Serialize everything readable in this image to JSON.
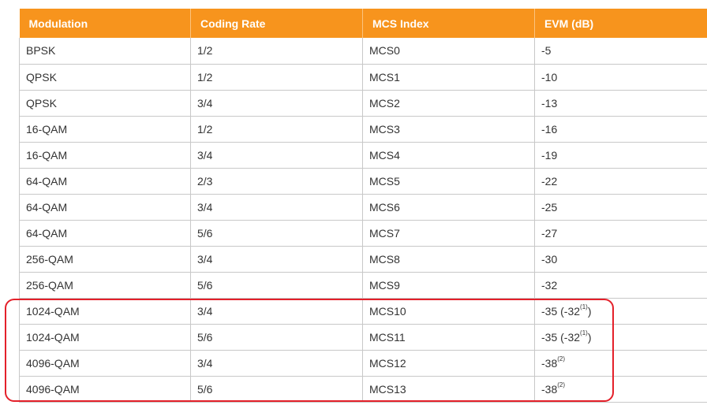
{
  "table": {
    "headers": [
      "Modulation",
      "Coding Rate",
      "MCS Index",
      "EVM (dB)"
    ],
    "rows": [
      {
        "modulation": "BPSK",
        "coding_rate": "1/2",
        "mcs": "MCS0",
        "evm": "-5",
        "note": ""
      },
      {
        "modulation": "QPSK",
        "coding_rate": "1/2",
        "mcs": "MCS1",
        "evm": "-10",
        "note": ""
      },
      {
        "modulation": "QPSK",
        "coding_rate": "3/4",
        "mcs": "MCS2",
        "evm": "-13",
        "note": ""
      },
      {
        "modulation": "16-QAM",
        "coding_rate": "1/2",
        "mcs": "MCS3",
        "evm": "-16",
        "note": ""
      },
      {
        "modulation": "16-QAM",
        "coding_rate": "3/4",
        "mcs": "MCS4",
        "evm": "-19",
        "note": ""
      },
      {
        "modulation": "64-QAM",
        "coding_rate": "2/3",
        "mcs": "MCS5",
        "evm": "-22",
        "note": ""
      },
      {
        "modulation": "64-QAM",
        "coding_rate": "3/4",
        "mcs": "MCS6",
        "evm": "-25",
        "note": ""
      },
      {
        "modulation": "64-QAM",
        "coding_rate": "5/6",
        "mcs": "MCS7",
        "evm": "-27",
        "note": ""
      },
      {
        "modulation": "256-QAM",
        "coding_rate": "3/4",
        "mcs": "MCS8",
        "evm": "-30",
        "note": ""
      },
      {
        "modulation": "256-QAM",
        "coding_rate": "5/6",
        "mcs": "MCS9",
        "evm": "-32",
        "note": ""
      },
      {
        "modulation": "1024-QAM",
        "coding_rate": "3/4",
        "mcs": "MCS10",
        "evm": "-35 (-32",
        "note": "(1)",
        "evm_suffix": ")"
      },
      {
        "modulation": "1024-QAM",
        "coding_rate": "5/6",
        "mcs": "MCS11",
        "evm": "-35 (-32",
        "note": "(1)",
        "evm_suffix": ")"
      },
      {
        "modulation": "4096-QAM",
        "coding_rate": "3/4",
        "mcs": "MCS12",
        "evm": "-38",
        "note": "(2)"
      },
      {
        "modulation": "4096-QAM",
        "coding_rate": "5/6",
        "mcs": "MCS13",
        "evm": "-38",
        "note": "(2)"
      }
    ]
  },
  "colors": {
    "header_bg": "#f7941d",
    "header_text": "#ffffff",
    "highlight": "#e4202a",
    "grid": "#c8c8c8"
  }
}
